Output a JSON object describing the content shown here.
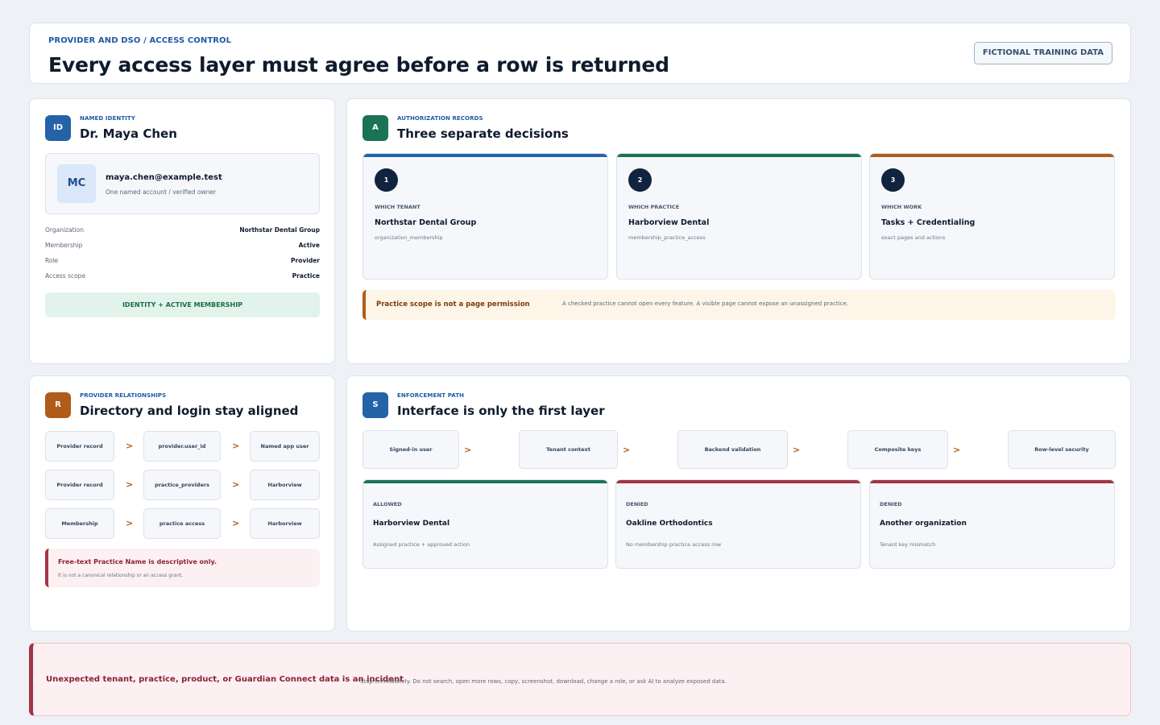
{
  "header": {
    "breadcrumb": "PROVIDER AND DSO / ACCESS CONTROL",
    "title": "Every access layer must agree before a row is returned",
    "badge": "FICTIONAL TRAINING DATA"
  },
  "identity": {
    "icon": "ID",
    "eyebrow": "NAMED IDENTITY",
    "title": "Dr. Maya Chen",
    "avatar": "MC",
    "email": "maya.chen@example.test",
    "subtitle": "One named account / verified owner",
    "details": [
      {
        "key": "Organization",
        "value": "Northstar Dental Group"
      },
      {
        "key": "Membership",
        "value": "Active"
      },
      {
        "key": "Role",
        "value": "Provider"
      },
      {
        "key": "Access scope",
        "value": "Practice"
      }
    ],
    "badge": "IDENTITY + ACTIVE MEMBERSHIP"
  },
  "auth": {
    "icon": "A",
    "eyebrow": "AUTHORIZATION RECORDS",
    "title": "Three separate decisions",
    "decisions": [
      {
        "num": "1",
        "label": "WHICH TENANT",
        "name": "Northstar Dental Group",
        "code": "organization_membership"
      },
      {
        "num": "2",
        "label": "WHICH PRACTICE",
        "name": "Harborview Dental",
        "code": "membership_practice_access"
      },
      {
        "num": "3",
        "label": "WHICH WORK",
        "name": "Tasks + Credentialing",
        "code": "exact pages and actions"
      }
    ],
    "note_strong": "Practice scope is not a page permission",
    "note_soft": "A checked practice cannot open every feature. A visible page cannot expose an unassigned practice."
  },
  "relations": {
    "icon": "R",
    "eyebrow": "PROVIDER RELATIONSHIPS",
    "title": "Directory and login stay aligned",
    "rows": [
      [
        "Provider record",
        "provider.user_id",
        "Named app user"
      ],
      [
        "Provider record",
        "practice_providers",
        "Harborview"
      ],
      [
        "Membership",
        "practice access",
        "Harborview"
      ]
    ],
    "arrow": ">",
    "warn_strong": "Free-text Practice Name is descriptive only.",
    "warn_soft": "It is not a canonical relationship or an access grant."
  },
  "enforce": {
    "icon": "S",
    "eyebrow": "ENFORCEMENT PATH",
    "title": "Interface is only the first layer",
    "path": [
      "Signed-in user",
      "Tenant context",
      "Backend validation",
      "Composite keys",
      "Row-level security"
    ],
    "arrow": ">",
    "outcomes": [
      {
        "label": "ALLOWED",
        "name": "Harborview Dental",
        "sub": "Assigned practice + approved action"
      },
      {
        "label": "DENIED",
        "name": "Oakline Orthodontics",
        "sub": "No membership practice access row"
      },
      {
        "label": "DENIED",
        "name": "Another organization",
        "sub": "Tenant key mismatch"
      }
    ]
  },
  "incident": {
    "strong": "Unexpected tenant, practice, product, or Guardian Connect data is an incident",
    "soft": "Stop immediately. Do not search, open more rows, copy, screenshot, download, change a role, or ask AI to analyze exposed data."
  },
  "colors": {
    "blue": "#2563a8",
    "green": "#1a7355",
    "orange": "#b15b1a",
    "red": "#a33446",
    "navy": "#10233f"
  }
}
